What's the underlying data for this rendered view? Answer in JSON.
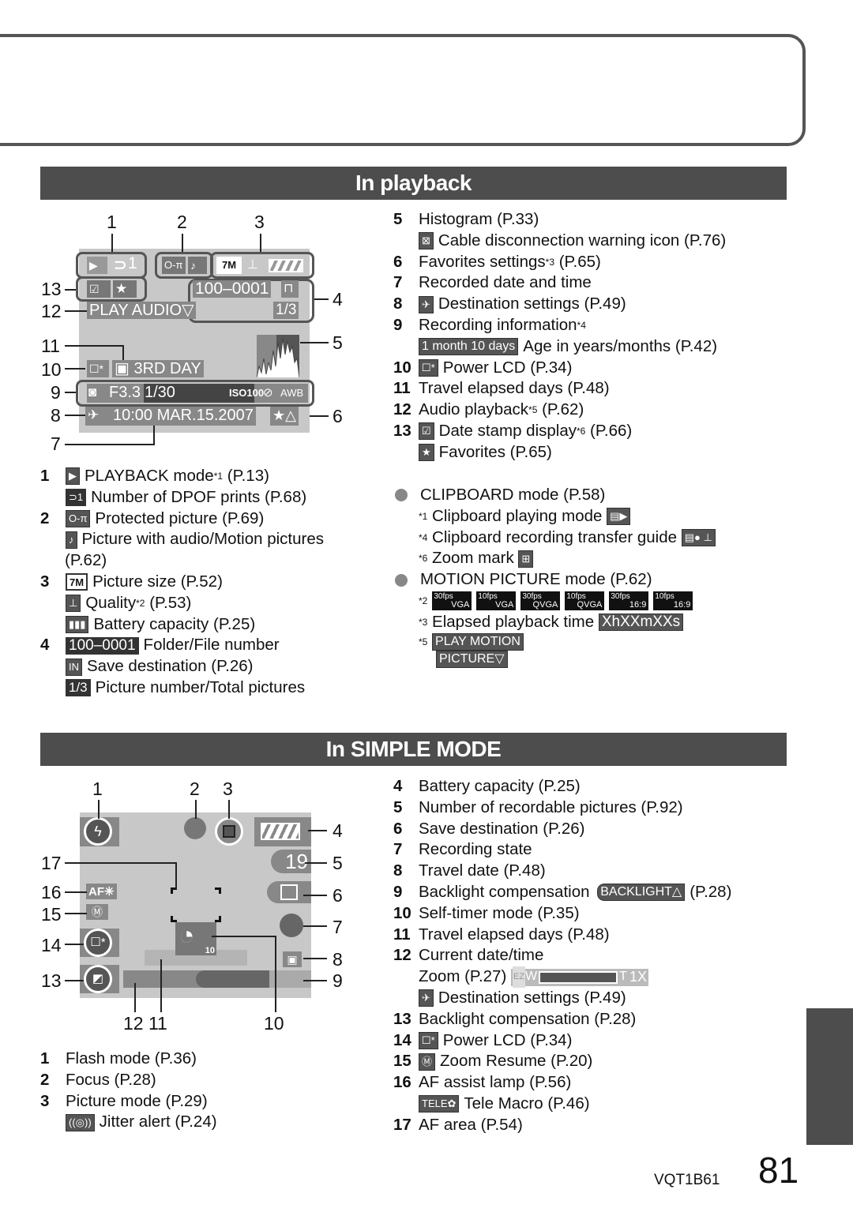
{
  "playback": {
    "title": "In playback",
    "lcd": {
      "callouts": [
        "1",
        "2",
        "3",
        "4",
        "5",
        "6",
        "7",
        "8",
        "9",
        "10",
        "11",
        "12",
        "13"
      ],
      "dpof_count": "1",
      "picture_size": "7M",
      "folder_file": "100–0001",
      "picture_count": "1/3",
      "audio": "PLAY AUDIO▽",
      "travel_day": "3RD DAY",
      "aperture": "F3.3",
      "shutter": "1/30",
      "iso": "ISO100",
      "wb": "AWB",
      "datetime": "10:00 MAR.15.2007",
      "fav": "★△"
    },
    "legend_left": [
      {
        "num": "1",
        "icon": "playback-mode-icon",
        "icon_text": "▶",
        "text": "PLAYBACK mode",
        "sup": "*1",
        "ref": "(P.13)"
      },
      {
        "num": "",
        "icon": "dpof-icon",
        "icon_text": "⊃1",
        "text": "Number of DPOF prints (P.68)"
      },
      {
        "num": "2",
        "icon": "protect-icon",
        "icon_text": "O‑π",
        "text": "Protected picture (P.69)"
      },
      {
        "num": "",
        "icon": "audio-icon",
        "icon_text": "♪",
        "text": "Picture with audio/Motion pictures"
      },
      {
        "num": "",
        "icon": "",
        "text": "(P.62)"
      },
      {
        "num": "3",
        "icon": "picture-size-icon",
        "icon_text": "7M",
        "text": "Picture size (P.52)"
      },
      {
        "num": "",
        "icon": "quality-icon",
        "icon_text": "⊥",
        "text": "Quality",
        "sup": "*2",
        "ref": "(P.53)"
      },
      {
        "num": "",
        "icon": "battery-icon",
        "icon_text": "▮▮▮",
        "text": "Battery capacity (P.25)"
      },
      {
        "num": "4",
        "icon": "folder-file-icon",
        "icon_text": "100–0001",
        "text": "Folder/File number"
      },
      {
        "num": "",
        "icon": "save-destination-icon",
        "icon_text": "IN",
        "text": "Save destination (P.26)"
      },
      {
        "num": "",
        "icon": "picture-number-icon",
        "icon_text": "1/3",
        "text": "Picture number/Total pictures"
      }
    ],
    "legend_right": [
      {
        "num": "5",
        "text": "Histogram (P.33)"
      },
      {
        "num": "",
        "icon": "cable-warning-icon",
        "icon_text": "⊠",
        "text": "Cable disconnection warning icon (P.76)"
      },
      {
        "num": "6",
        "text": "Favorites settings",
        "sup": "*3",
        "ref": "(P.65)"
      },
      {
        "num": "7",
        "text": "Recorded date and time"
      },
      {
        "num": "8",
        "icon": "destination-icon",
        "icon_text": "✈",
        "text": "Destination settings (P.49)"
      },
      {
        "num": "9",
        "text": "Recording information",
        "sup": "*4",
        "ref": ""
      },
      {
        "num": "",
        "icon": "age-icon",
        "icon_text": "1 month 10 days",
        "text": "Age in years/months (P.42)"
      },
      {
        "num": "10",
        "icon": "power-lcd-icon",
        "icon_text": "☐*",
        "text": "Power LCD (P.34)"
      },
      {
        "num": "11",
        "text": "Travel elapsed days (P.48)"
      },
      {
        "num": "12",
        "text": "Audio playback",
        "sup": "*5",
        "ref": "(P.62)"
      },
      {
        "num": "13",
        "icon": "date-stamp-icon",
        "icon_text": "☑",
        "text": "Date stamp display",
        "sup": "*6",
        "ref": "(P.66)"
      },
      {
        "num": "",
        "icon": "favorites-icon",
        "icon_text": "★",
        "text": "Favorites (P.65)"
      }
    ],
    "notes": {
      "clipboard_title": "CLIPBOARD mode (P.58)",
      "clip1_mark": "*1",
      "clip1": "Clipboard playing mode",
      "clip4_mark": "*4",
      "clip4": "Clipboard recording transfer guide",
      "clip6_mark": "*6",
      "clip6": "Zoom mark",
      "motion_title": "MOTION PICTURE mode (P.62)",
      "m2_mark": "*2",
      "fps_icons": [
        {
          "a": "30fps",
          "b": "VGA"
        },
        {
          "a": "10fps",
          "b": "VGA"
        },
        {
          "a": "30fps",
          "b": "QVGA"
        },
        {
          "a": "10fps",
          "b": "QVGA"
        },
        {
          "a": "30fps",
          "b": "16:9"
        },
        {
          "a": "10fps",
          "b": "16:9"
        }
      ],
      "m3_mark": "*3",
      "m3": "Elapsed playback time",
      "m3_icon": "XhXXmXXs",
      "m5_mark": "*5",
      "m5_line1": "PLAY MOTION",
      "m5_line2": "PICTURE▽"
    }
  },
  "simple": {
    "title": "In SIMPLE MODE",
    "lcd": {
      "callouts": [
        "1",
        "2",
        "3",
        "4",
        "5",
        "6",
        "7",
        "8",
        "9",
        "10",
        "11",
        "12",
        "13",
        "14",
        "15",
        "16",
        "17"
      ],
      "shots_left": "19",
      "af_assist": "AF✳",
      "timer": "10",
      "bottom_labels": [
        "12 11",
        "10"
      ]
    },
    "legend_left": [
      {
        "num": "1",
        "text": "Flash mode (P.36)"
      },
      {
        "num": "2",
        "text": "Focus (P.28)"
      },
      {
        "num": "3",
        "text": "Picture mode (P.29)"
      },
      {
        "num": "",
        "icon": "jitter-alert-icon",
        "icon_text": "((◎))",
        "text": "Jitter alert (P.24)"
      }
    ],
    "legend_right": [
      {
        "num": "4",
        "text": "Battery capacity (P.25)"
      },
      {
        "num": "5",
        "text": "Number of recordable pictures (P.92)"
      },
      {
        "num": "6",
        "text": "Save destination (P.26)"
      },
      {
        "num": "7",
        "text": "Recording state"
      },
      {
        "num": "8",
        "text": "Travel date (P.48)"
      },
      {
        "num": "9",
        "text": "Backlight compensation",
        "inline_icon": "BACKLIGHT△",
        "ref": "(P.28)"
      },
      {
        "num": "10",
        "text": "Self-timer mode (P.35)"
      },
      {
        "num": "11",
        "text": "Travel elapsed days (P.48)"
      },
      {
        "num": "12",
        "text": "Current date/time"
      },
      {
        "num": "",
        "text": "Zoom (P.27)",
        "zoom_icon": {
          "ez": "EZ",
          "w": "W",
          "t": "T",
          "x": "1X"
        }
      },
      {
        "num": "",
        "icon": "destination-icon",
        "icon_text": "✈",
        "text": "Destination settings (P.49)"
      },
      {
        "num": "13",
        "text": "Backlight compensation (P.28)"
      },
      {
        "num": "14",
        "icon": "power-lcd-icon",
        "icon_text": "☐*",
        "text": "Power LCD (P.34)"
      },
      {
        "num": "15",
        "icon": "zoom-resume-icon",
        "icon_text": "Ⓜ",
        "text": "Zoom Resume (P.20)"
      },
      {
        "num": "16",
        "text": "AF assist lamp (P.56)"
      },
      {
        "num": "",
        "icon": "tele-macro-icon",
        "icon_text": "TELE✿",
        "text": "Tele Macro (P.46)"
      },
      {
        "num": "17",
        "text": "AF area (P.54)"
      }
    ]
  },
  "footer": {
    "code": "VQT1B61",
    "page": "81"
  }
}
